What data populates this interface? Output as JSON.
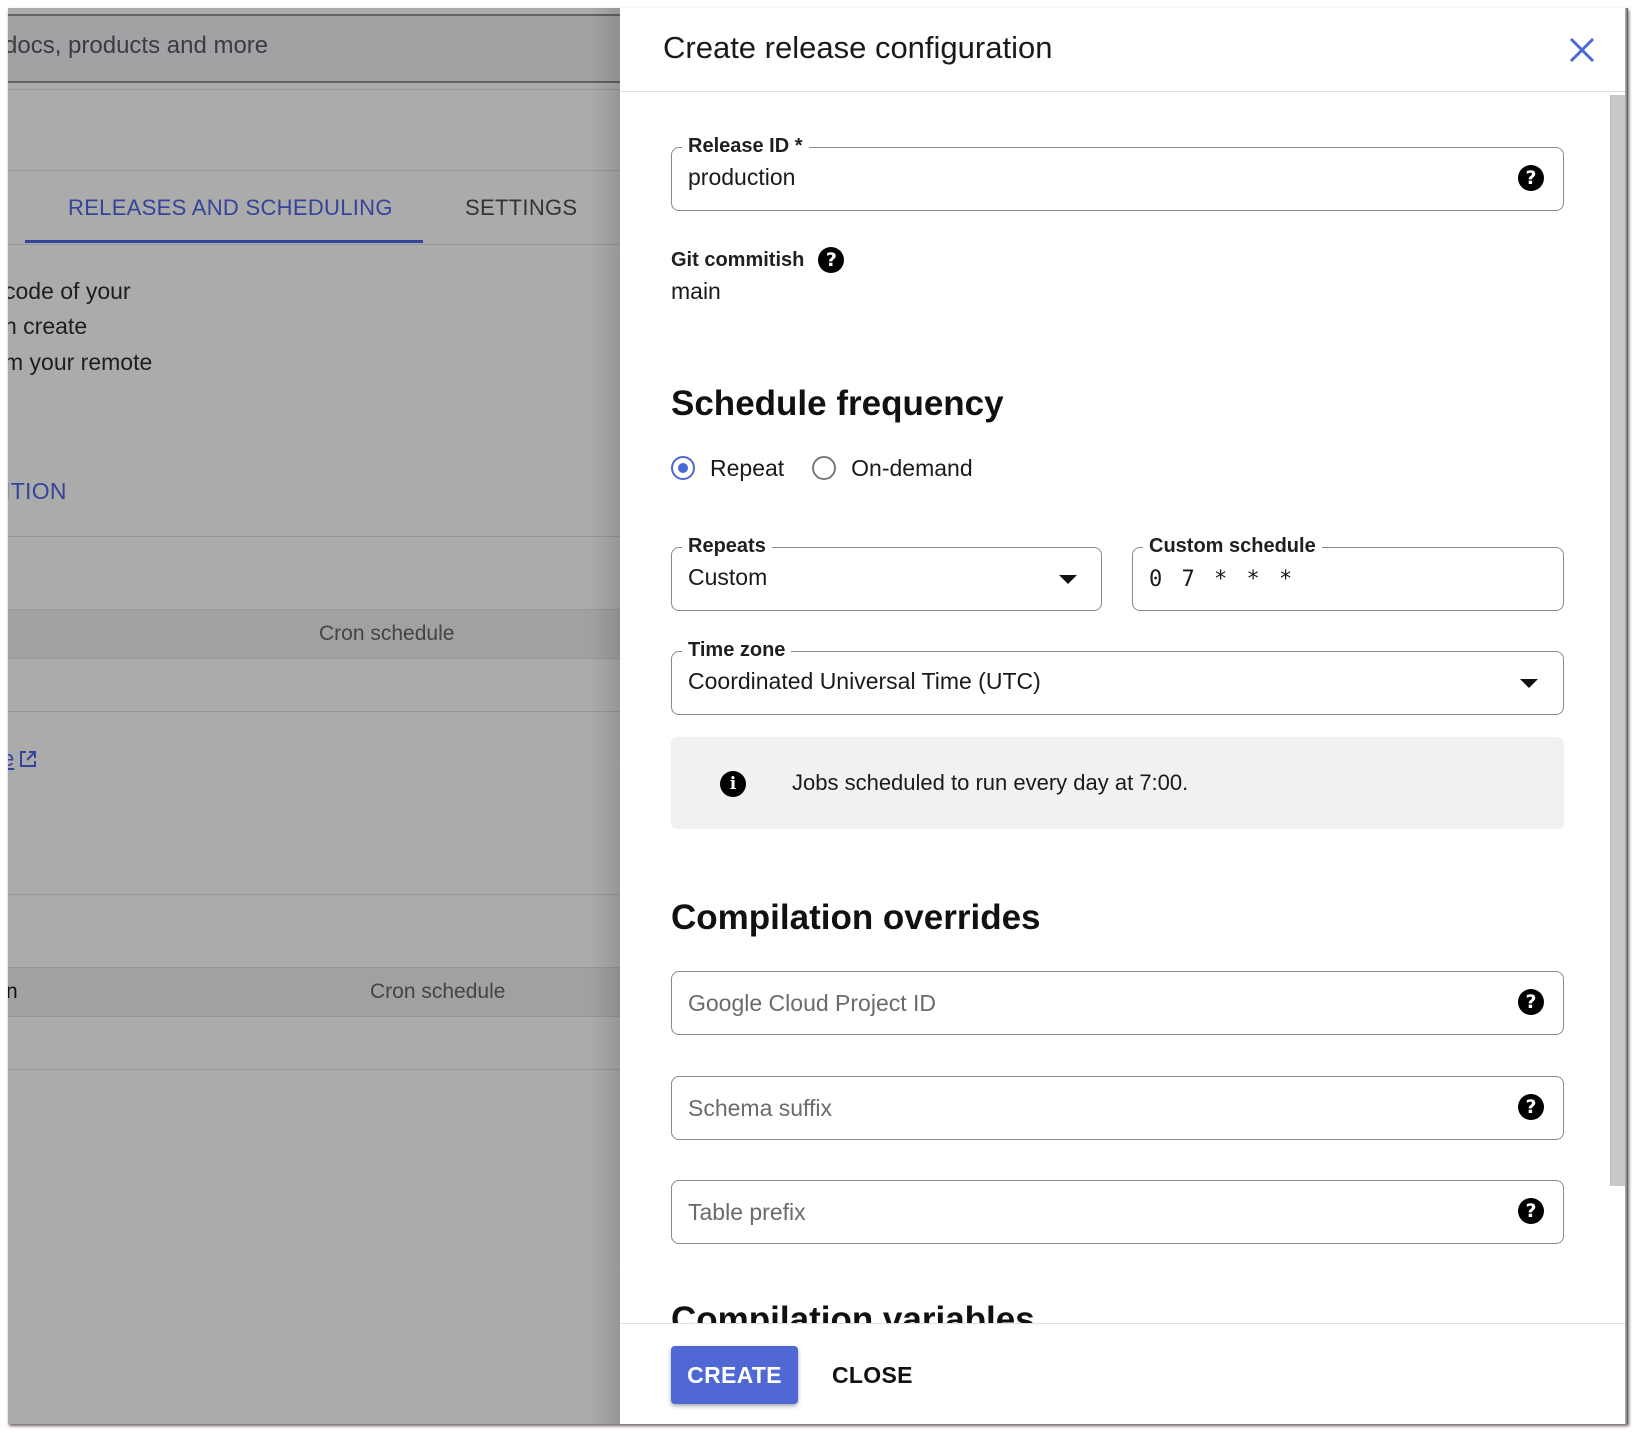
{
  "backdrop": {
    "search_placeholder_fragment": "docs, products and more",
    "tabs": [
      {
        "label": "RELEASES AND SCHEDULING",
        "active": true
      },
      {
        "label": "SETTINGS",
        "active": false
      }
    ],
    "description_lines": [
      "code of your",
      "n create",
      "m your remote"
    ],
    "section_link_fragment": "ITION",
    "table1_header": {
      "cron_schedule": "Cron schedule"
    },
    "external_link_fragment": "e",
    "table2_header": {
      "left_fragment": "n",
      "cron_schedule": "Cron schedule"
    }
  },
  "panel": {
    "title": "Create release configuration",
    "close_icon": "close-icon",
    "release_id": {
      "label": "Release ID *",
      "value": "production"
    },
    "git_commitish": {
      "label": "Git commitish",
      "value": "main"
    },
    "schedule_frequency": {
      "heading": "Schedule frequency",
      "options": [
        {
          "label": "Repeat",
          "selected": true
        },
        {
          "label": "On-demand",
          "selected": false
        }
      ],
      "repeats": {
        "label": "Repeats",
        "value": "Custom"
      },
      "custom_schedule": {
        "label": "Custom schedule",
        "value": "0 7 * * *"
      },
      "time_zone": {
        "label": "Time zone",
        "value": "Coordinated Universal Time (UTC)"
      },
      "info": "Jobs scheduled to run every day at 7:00."
    },
    "compilation_overrides": {
      "heading": "Compilation overrides",
      "fields": [
        {
          "placeholder": "Google Cloud Project ID"
        },
        {
          "placeholder": "Schema suffix"
        },
        {
          "placeholder": "Table prefix"
        }
      ]
    },
    "compilation_variables": {
      "heading": "Compilation variables"
    },
    "footer": {
      "create_label": "CREATE",
      "close_label": "CLOSE"
    }
  },
  "colors": {
    "accent": "#5068d4",
    "link": "#34449a",
    "backdrop": "#ababab",
    "info_bg": "#f1f1f1"
  }
}
